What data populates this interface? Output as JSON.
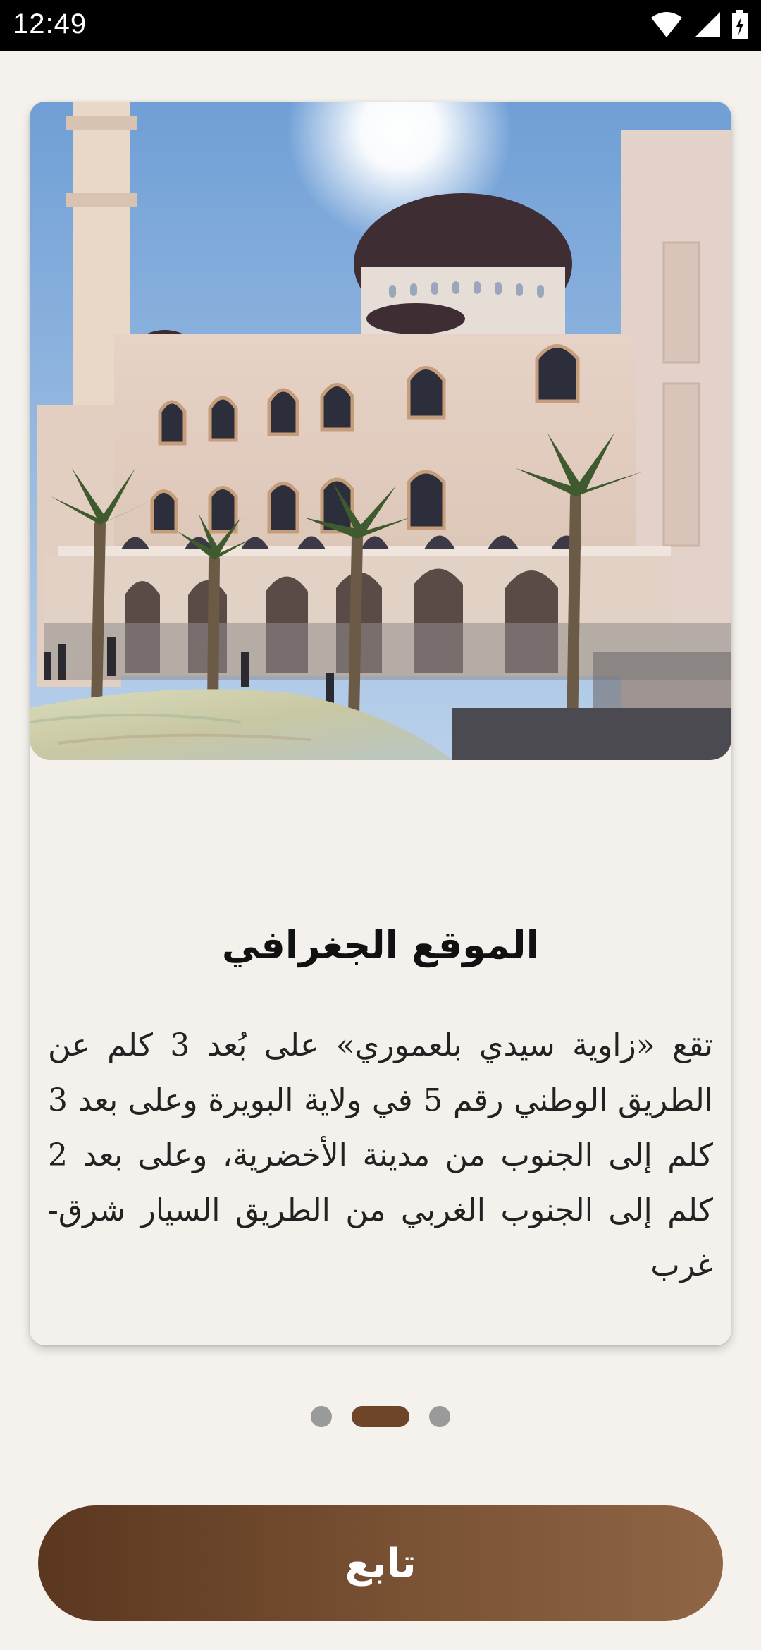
{
  "status_bar": {
    "time": "12:49",
    "icons": [
      "wifi-icon",
      "signal-icon",
      "battery-icon"
    ]
  },
  "card": {
    "image_alt": "mosque-photo",
    "title": "الموقع الجغرافي",
    "body": "تقع «زاوية سيدي بلعموري» على بُعد 3 كلم عن الطريق الوطني رقم 5 في ولاية البويرة وعلى بعد 3 كلم إلى الجنوب من مدينة الأخضرية، وعلى بعد 2 كلم إلى الجنوب الغربي من الطريق السيار شرق-غرب"
  },
  "pager": {
    "count": 3,
    "active_index": 1
  },
  "continue_button": {
    "label": "تابع"
  },
  "colors": {
    "background": "#f5f2ed",
    "card": "#f4f1ec",
    "accent": "#6e4528",
    "dot_inactive": "#9a9a9a"
  }
}
